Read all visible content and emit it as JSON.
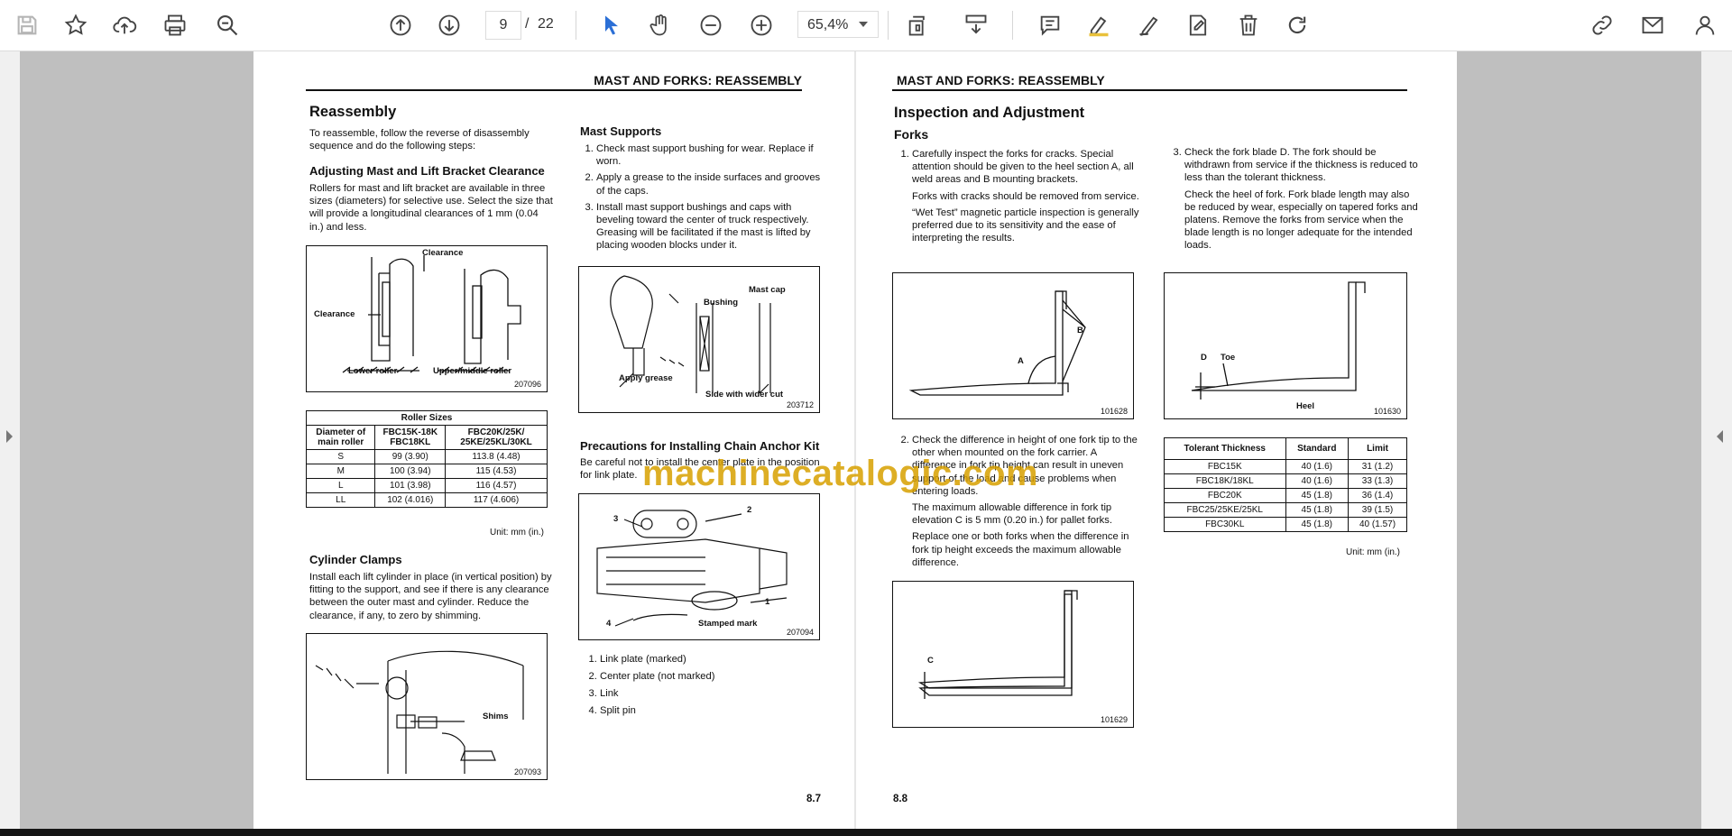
{
  "toolbar": {
    "page_current": "9",
    "page_separator": "/",
    "page_total": "22",
    "zoom": "65,4%",
    "accent_color": "#2b6fd6"
  },
  "left_page": {
    "header": "MAST AND FORKS: REASSEMBLY",
    "title": "Reassembly",
    "intro": "To reassemble, follow the reverse of disassembly sequence and do the following steps:",
    "sec_adjust_title": "Adjusting Mast and Lift Bracket Clearance",
    "sec_adjust_text": "Rollers for mast and lift bracket are available in three sizes (diameters) for selective use. Select the size that will provide a longitudinal clearances of 1 mm (0.04 in.) and less.",
    "fig1": {
      "label_clearance_top": "Clearance",
      "label_clearance_left": "Clearance",
      "label_lower": "Lower roller",
      "label_upper": "Upper/middle roller",
      "num": "207096"
    },
    "roller_table": {
      "caption": "Roller Sizes",
      "headers": [
        "Diameter of main roller",
        "FBC15K-18K FBC18KL",
        "FBC20K/25K/ 25KE/25KL/30KL"
      ],
      "rows": [
        [
          "S",
          "99 (3.90)",
          "113.8 (4.48)"
        ],
        [
          "M",
          "100 (3.94)",
          "115 (4.53)"
        ],
        [
          "L",
          "101 (3.98)",
          "116 (4.57)"
        ],
        [
          "LL",
          "102 (4.016)",
          "117 (4.606)"
        ]
      ],
      "unit": "Unit: mm (in.)"
    },
    "sec_cyl_title": "Cylinder Clamps",
    "sec_cyl_text": "Install each lift cylinder in place (in vertical position) by fitting to the support, and see if there is any clearance between the outer mast and cylinder. Reduce the clearance, if any, to zero by shimming.",
    "fig3": {
      "label_shims": "Shims",
      "num": "207093"
    },
    "sec_mast_title": "Mast Supports",
    "mast_steps": [
      "Check mast support bushing for wear. Replace if worn.",
      "Apply a grease to the inside surfaces and grooves of the caps.",
      "Install mast support bushings and caps with beveling toward the center of truck respectively. Greasing will be facilitated if the mast is lifted by placing wooden blocks under it."
    ],
    "fig2": {
      "label_bushing": "Bushing",
      "label_mastcap": "Mast cap",
      "label_grease": "Apply grease",
      "label_side": "Side with wider cut",
      "num": "203712"
    },
    "sec_chain_title": "Precautions for Installing Chain Anchor Kit",
    "sec_chain_text": "Be careful not to install the center plate in the position for link plate.",
    "fig4": {
      "n1": "1",
      "n2": "2",
      "n3": "3",
      "n4": "4",
      "label_stamped": "Stamped mark",
      "num": "207094"
    },
    "chain_list": [
      "Link plate (marked)",
      "Center plate (not marked)",
      "Link",
      "Split pin"
    ],
    "page_number": "8.7"
  },
  "right_page": {
    "header": "MAST AND FORKS: REASSEMBLY",
    "title": "Inspection and Adjustment",
    "subtitle": "Forks",
    "step1": "Carefully inspect the forks for cracks. Special attention should be given to the heel section A, all weld areas and B mounting brackets.",
    "step1_p2": "Forks with cracks should be removed from service.",
    "step1_p3": "“Wet Test” magnetic particle inspection is generally preferred due to its sensitivity and the ease of interpreting the results.",
    "fig5": {
      "label_a": "A",
      "label_b": "B",
      "num": "101628"
    },
    "step2": "Check the difference in height of one fork tip to the other when mounted on the fork carrier. A difference in fork tip height can result in uneven support of the load and cause problems when entering loads.",
    "step2_p2": "The maximum allowable difference in fork tip elevation C is 5 mm (0.20 in.) for pallet forks.",
    "step2_p3": "Replace one or both forks when the difference in fork tip height exceeds the maximum allowable difference.",
    "fig6": {
      "label_c": "C",
      "num": "101629"
    },
    "step3": "Check the fork blade D. The fork should be withdrawn from service if the thickness is reduced to less than the tolerant thickness.",
    "step3_p2": "Check the heel of fork. Fork blade length may also be reduced by wear, especially on tapered forks and platens. Remove the forks from service when the blade length is no longer adequate for the intended loads.",
    "fig7": {
      "label_d": "D",
      "label_toe": "Toe",
      "label_heel": "Heel",
      "num": "101630"
    },
    "tol_table": {
      "headers": [
        "Tolerant Thickness",
        "Standard",
        "Limit"
      ],
      "rows": [
        [
          "FBC15K",
          "40 (1.6)",
          "31 (1.2)"
        ],
        [
          "FBC18K/18KL",
          "40 (1.6)",
          "33 (1.3)"
        ],
        [
          "FBC20K",
          "45 (1.8)",
          "36 (1.4)"
        ],
        [
          "FBC25/25KE/25KL",
          "45 (1.8)",
          "39 (1.5)"
        ],
        [
          "FBC30KL",
          "45 (1.8)",
          "40 (1.57)"
        ]
      ],
      "unit": "Unit: mm (in.)"
    },
    "page_number": "8.8"
  },
  "watermark": "machinecatalogic.com"
}
